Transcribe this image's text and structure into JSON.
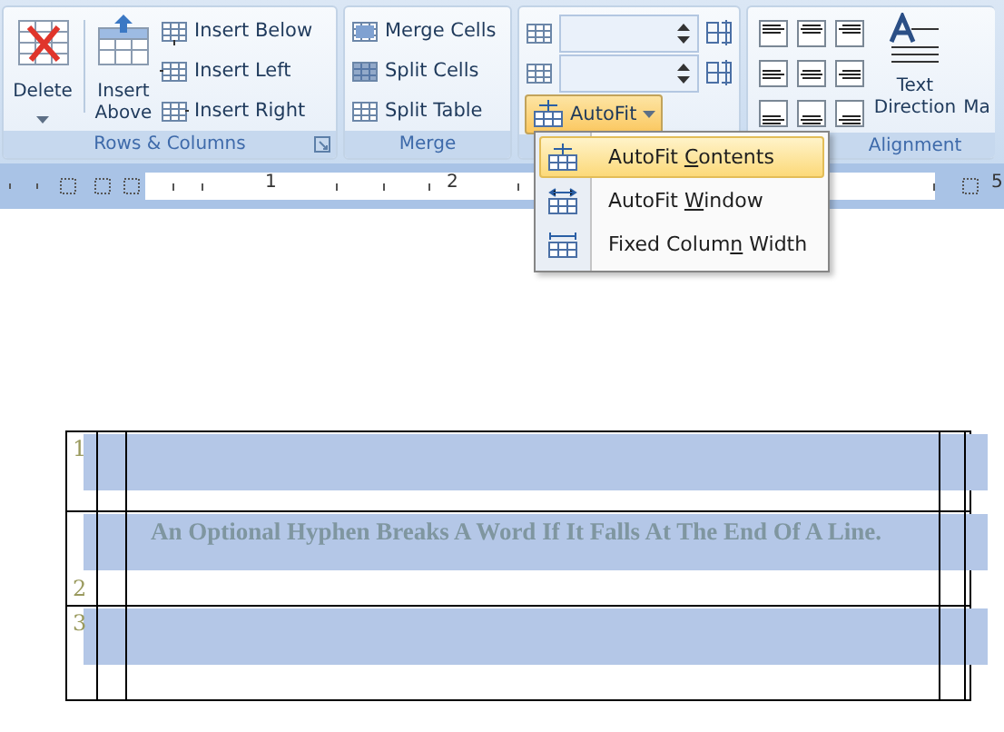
{
  "ribbon": {
    "groups": [
      {
        "kind": "rows",
        "label": "Rows & Columns",
        "large": [
          {
            "label": "Delete"
          },
          {
            "label": "Insert Above"
          }
        ],
        "small": [
          {
            "label": "Insert Below"
          },
          {
            "label": "Insert Left"
          },
          {
            "label": "Insert Right"
          }
        ]
      },
      {
        "kind": "merge",
        "label": "Merge",
        "small": [
          {
            "label": "Merge Cells"
          },
          {
            "label": "Split Cells"
          },
          {
            "label": "Split Table"
          }
        ]
      },
      {
        "kind": "size",
        "autofit": {
          "label": "AutoFit",
          "selected": true
        }
      },
      {
        "kind": "align",
        "label": "Alignment",
        "aligns": [
          {
            "selected": false
          },
          {
            "selected": false
          },
          {
            "selected": false
          },
          {
            "selected": false
          },
          {
            "selected": false
          },
          {
            "selected": false
          },
          {
            "selected": false
          },
          {
            "selected": false
          },
          {
            "selected": false
          }
        ],
        "large": [
          {
            "label": "Text Direction"
          }
        ],
        "cut": "Ma"
      }
    ]
  },
  "ruler": {
    "numbers": [
      "1",
      "2",
      "5"
    ]
  },
  "menu": {
    "items": [
      {
        "parts": [
          "AutoFit ",
          "C",
          "ontents"
        ],
        "selected": true
      },
      {
        "parts": [
          "AutoFit ",
          "W",
          "indow"
        ],
        "selected": false
      },
      {
        "parts": [
          "Fixed Colum",
          "n",
          " Width"
        ],
        "selected": false
      }
    ]
  },
  "table": {
    "rows": [
      {
        "number": "1",
        "text": ""
      },
      {
        "number": "2",
        "text": "An Optional Hyphen Breaks A Word If It Falls At The End Of A Line."
      },
      {
        "number": "3",
        "text": ""
      }
    ]
  }
}
